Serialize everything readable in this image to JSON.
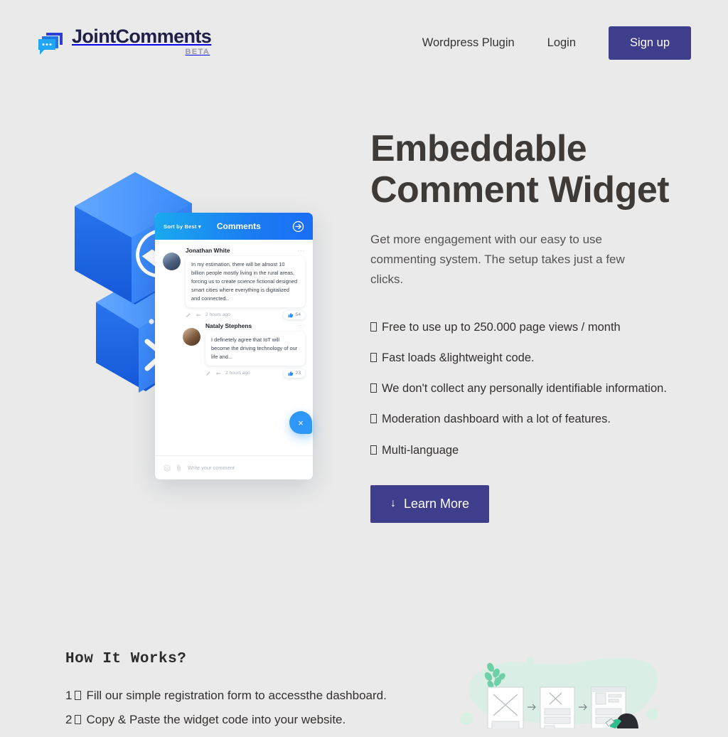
{
  "brand": {
    "name": "JointComments",
    "tag": "BETA",
    "mark_icon": "chat-bubble-icon"
  },
  "nav": {
    "links": [
      {
        "label": "Wordpress Plugin",
        "name": "nav-wordpress-plugin"
      },
      {
        "label": "Login",
        "name": "nav-login"
      }
    ],
    "signup_label": "Sign up",
    "signup_color": "#3e3e8c"
  },
  "hero": {
    "title": "Embeddable Comment Widget",
    "subtitle": "Get more engagement with our easy to use commenting system. The setup takes just a few clicks.",
    "features": [
      "Free to use up to 250.000 page views / month",
      "Fast loads &lightweight code.",
      "We don't collect any personally identifiable information.",
      "Moderation dashboard with a lot of features.",
      "Multi-language"
    ],
    "cta_label": "Learn More",
    "cta_arrow": "↓",
    "cta_color": "#3e3e8c"
  },
  "widget": {
    "sort_label": "Sort by Best",
    "sort_caret": "▾",
    "title": "Comments",
    "login_icon": "login-arrow-icon",
    "header_gradient_from": "#1aa9f0",
    "header_gradient_to": "#1a6ef5",
    "comments": [
      {
        "author": "Jonathan White",
        "text": "In my estimation, there will be almost 10 billion people mostly living in the rural areas, forcing us to create science fictional designed smart cities where everything is digitalized and connected..",
        "time": "2 hours ago",
        "likes": "54",
        "menu": "···"
      },
      {
        "author": "Nataly Stephens",
        "text": "I definetely agree that IoT will become the driving technology of our life and...",
        "time": "2 hours ago",
        "likes": "23",
        "menu": "···"
      }
    ],
    "composer_placeholder": "Write your comment",
    "close_glyph": "×"
  },
  "iso": {
    "wordpress_icon": "wordpress-logo-icon",
    "terminal_icon": "terminal-prompt-icon",
    "color": "#2f80f5"
  },
  "how": {
    "title": "How It Works?",
    "steps": [
      {
        "num": "1",
        "text": "Fill our simple registration form to accessthe dashboard."
      },
      {
        "num": "2",
        "text": "Copy & Paste the widget code into your website."
      }
    ],
    "illustration": "wireframe-steps-illustration",
    "illustration_accent": "#9fdcc4"
  }
}
